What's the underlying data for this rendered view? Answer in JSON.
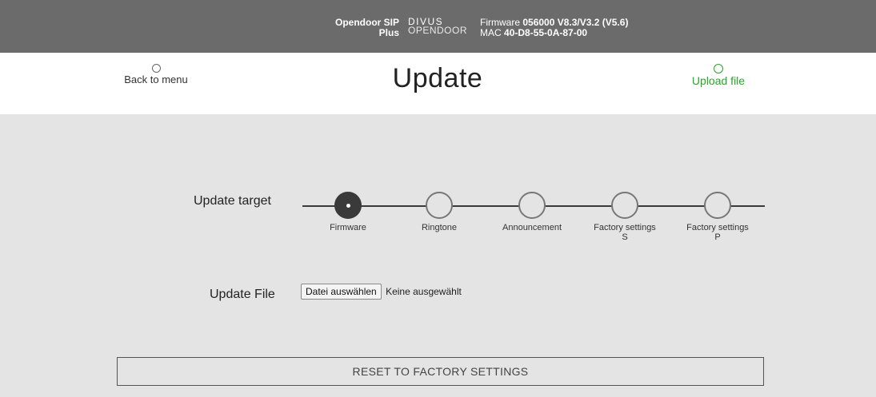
{
  "topbar": {
    "product_line1": "Opendoor SIP",
    "product_line2": "Plus",
    "logo_line1": "DIVUS",
    "logo_line2": "OPENDOOR",
    "firmware_label": "Firmware",
    "firmware_value": "056000 V8.3/V3.2 (V5.6)",
    "mac_label": "MAC",
    "mac_value": "40-D8-55-0A-87-00"
  },
  "header": {
    "back_label": "Back to menu",
    "title": "Update",
    "upload_label": "Upload file"
  },
  "form": {
    "target_label": "Update target",
    "file_label": "Update File",
    "steps": [
      {
        "line1": "Firmware",
        "line2": ""
      },
      {
        "line1": "Ringtone",
        "line2": ""
      },
      {
        "line1": "Announcement",
        "line2": ""
      },
      {
        "line1": "Factory settings",
        "line2": "S"
      },
      {
        "line1": "Factory settings",
        "line2": "P"
      }
    ],
    "selected_step": "Firmware",
    "file_button": "Datei auswählen",
    "file_status": "Keine ausgewählt",
    "reset_label": "RESET TO FACTORY SETTINGS"
  },
  "colors": {
    "topbar_bg": "#6b6b6b",
    "content_bg": "#e4e4e4",
    "accent_green": "#22aa22",
    "step_active": "#3a3a3a"
  }
}
